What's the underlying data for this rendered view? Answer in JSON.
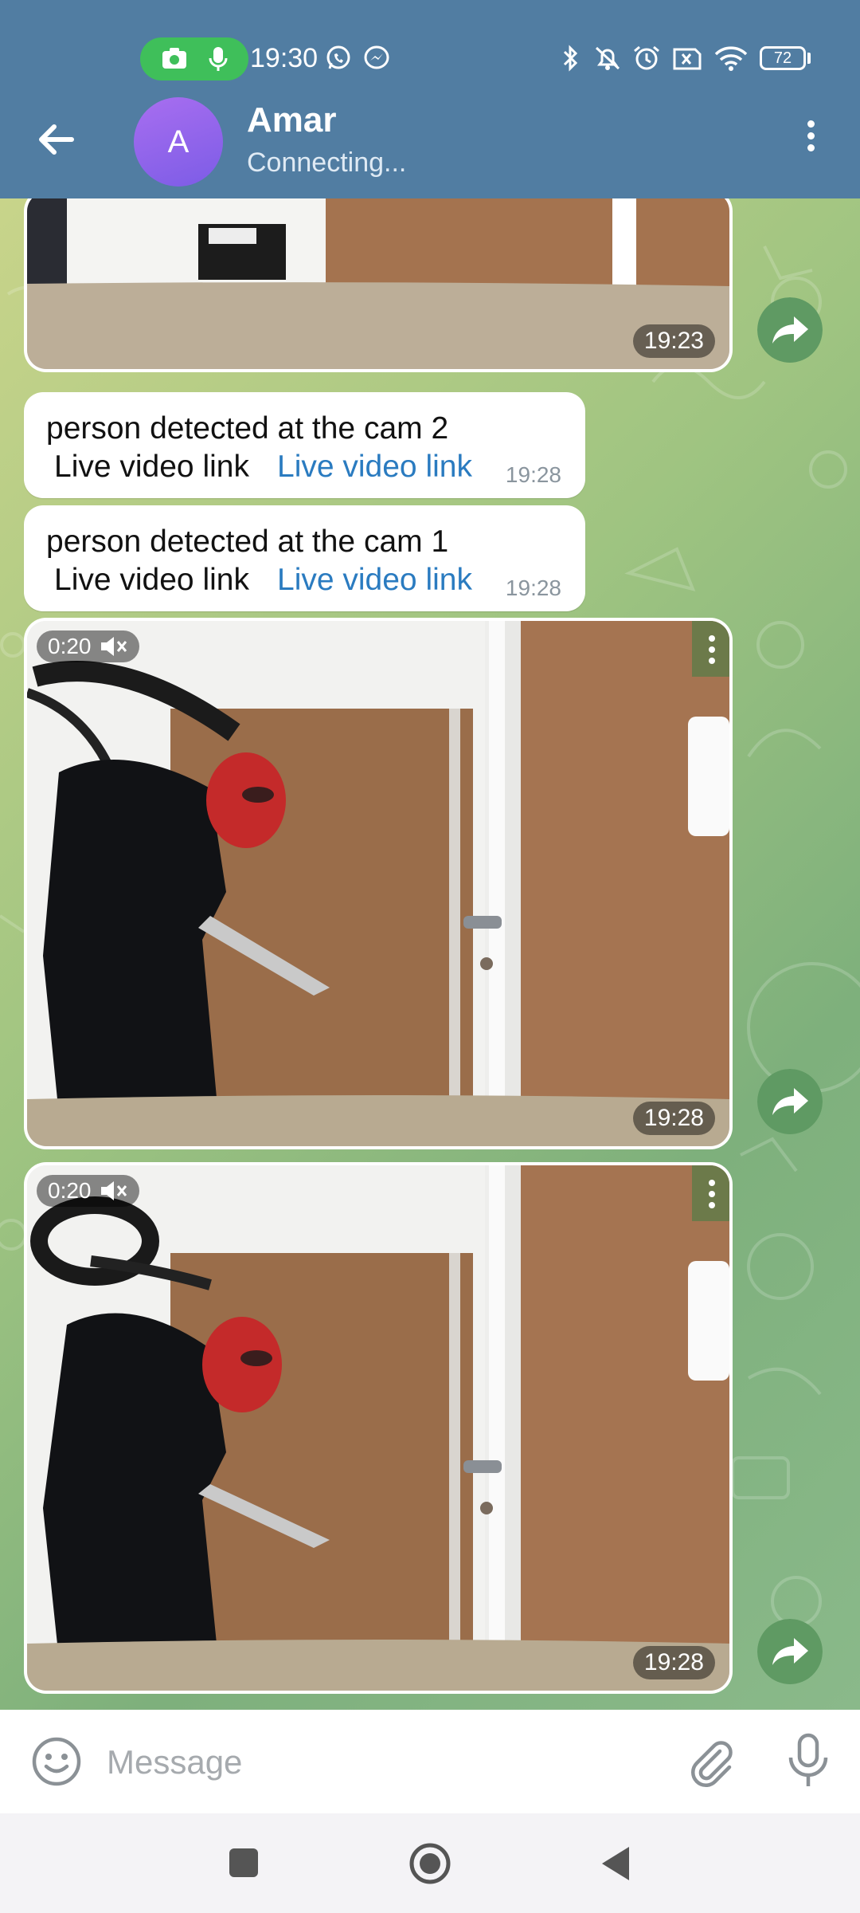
{
  "status_bar": {
    "time": "19:30",
    "battery": "72",
    "icons": [
      "camera-icon",
      "mic-icon",
      "whatsapp-icon",
      "messenger-icon",
      "bluetooth-icon",
      "bell-off-icon",
      "alarm-icon",
      "sim-off-icon",
      "wifi-icon",
      "battery-icon"
    ]
  },
  "header": {
    "avatar_letter": "A",
    "title": "Amar",
    "subtitle": "Connecting...",
    "colors": {
      "bar": "#517da2",
      "avatar": "#8a63ea"
    }
  },
  "messages": [
    {
      "type": "video",
      "time": "19:23"
    },
    {
      "type": "text",
      "text": "person detected at the cam 2",
      "line2": "Live video link",
      "link": "Live video link",
      "time": "19:28"
    },
    {
      "type": "text",
      "text": "person detected at the cam 1",
      "line2": "Live video link",
      "link": "Live video link",
      "time": "19:28"
    },
    {
      "type": "video",
      "duration": "0:20",
      "time": "19:28"
    },
    {
      "type": "video",
      "duration": "0:20",
      "time": "19:28"
    }
  ],
  "composer": {
    "placeholder": "Message"
  },
  "colors": {
    "link": "#2a7bc0",
    "share_button": "#5f9a63"
  }
}
